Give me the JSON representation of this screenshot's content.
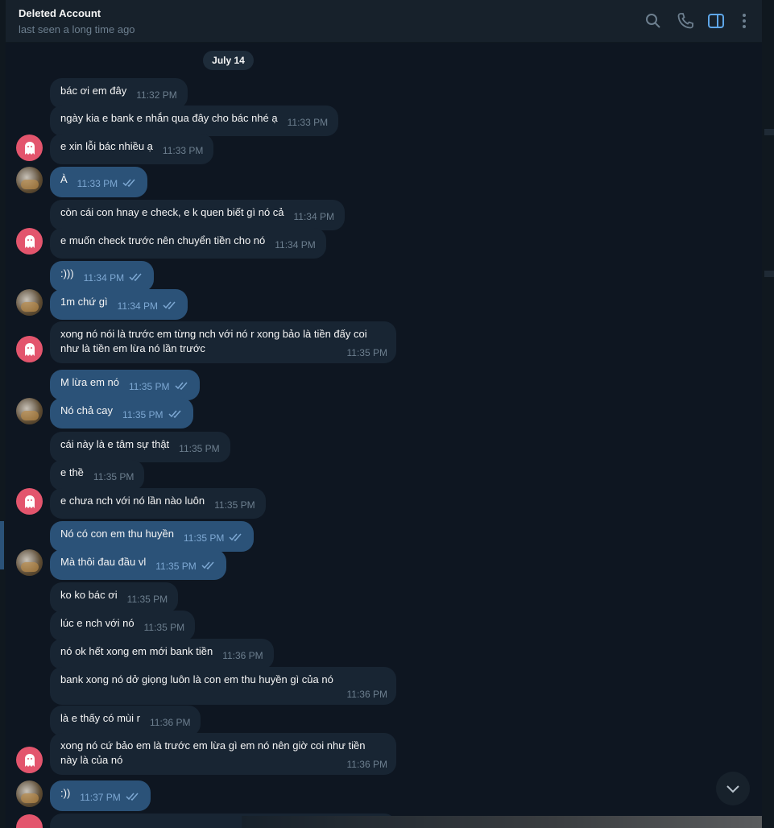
{
  "header": {
    "title": "Deleted Account",
    "status": "last seen a long time ago",
    "icons": [
      "search-icon",
      "phone-icon",
      "sidebar-toggle-icon",
      "more-vertical-icon"
    ],
    "accent": "#5ea6e8"
  },
  "date_separator": "July 14",
  "messages": [
    {
      "dir": "in",
      "text": "bác ơi em đây",
      "time": "11:32 PM"
    },
    {
      "dir": "in",
      "text": "ngày kia e bank e nhắn qua đây cho bác nhé ạ",
      "time": "11:33 PM"
    },
    {
      "dir": "in",
      "text": "e xin lỗi bác nhiều ạ",
      "time": "11:33 PM"
    },
    {
      "dir": "out",
      "text": "À",
      "time": "11:33 PM"
    },
    {
      "dir": "in",
      "text": "còn cái con hnay e check, e k quen biết gì nó cả",
      "time": "11:34 PM"
    },
    {
      "dir": "in",
      "text": "e muốn check trước nên chuyển tiền cho nó",
      "time": "11:34 PM"
    },
    {
      "dir": "out",
      "text": ":)))",
      "time": "11:34 PM"
    },
    {
      "dir": "out",
      "text": "1m chứ gì",
      "time": "11:34 PM"
    },
    {
      "dir": "in",
      "text": "xong nó nói là trước em từng nch với nó r xong bảo là tiền đấy coi như là tiền em lừa nó lần trước",
      "time": "11:35 PM"
    },
    {
      "dir": "out",
      "text": "M lừa em nó",
      "time": "11:35 PM"
    },
    {
      "dir": "out",
      "text": "Nó chả cay",
      "time": "11:35 PM"
    },
    {
      "dir": "in",
      "text": "cái này là e tâm sự thật",
      "time": "11:35 PM"
    },
    {
      "dir": "in",
      "text": "e thề",
      "time": "11:35 PM"
    },
    {
      "dir": "in",
      "text": "e chưa nch với nó lần nào luôn",
      "time": "11:35 PM"
    },
    {
      "dir": "out",
      "text": "Nó có con em thu huyền",
      "time": "11:35 PM"
    },
    {
      "dir": "out",
      "text": "Mà thôi đau đầu vl",
      "time": "11:35 PM"
    },
    {
      "dir": "in",
      "text": "ko ko bác ơi",
      "time": "11:35 PM"
    },
    {
      "dir": "in",
      "text": "lúc e nch với nó",
      "time": "11:35 PM"
    },
    {
      "dir": "in",
      "text": "nó ok hết xong em mới bank tiền",
      "time": "11:36 PM"
    },
    {
      "dir": "in",
      "text": "bank xong nó dở giọng luôn là con em thu huyền gì của nó",
      "time": "11:36 PM"
    },
    {
      "dir": "in",
      "text": "là e thấy có mùi r",
      "time": "11:36 PM"
    },
    {
      "dir": "in",
      "text": "xong nó cứ bảo em là trước em lừa gì em nó nên giờ coi như tiền này là của nó",
      "time": "11:36 PM"
    },
    {
      "dir": "out",
      "text": ":))",
      "time": "11:37 PM"
    }
  ],
  "colors": {
    "incoming_bubble": "#182533",
    "outgoing_bubble": "#2b5278",
    "background": "#0e1621",
    "ghost_avatar": "#e3556d"
  }
}
